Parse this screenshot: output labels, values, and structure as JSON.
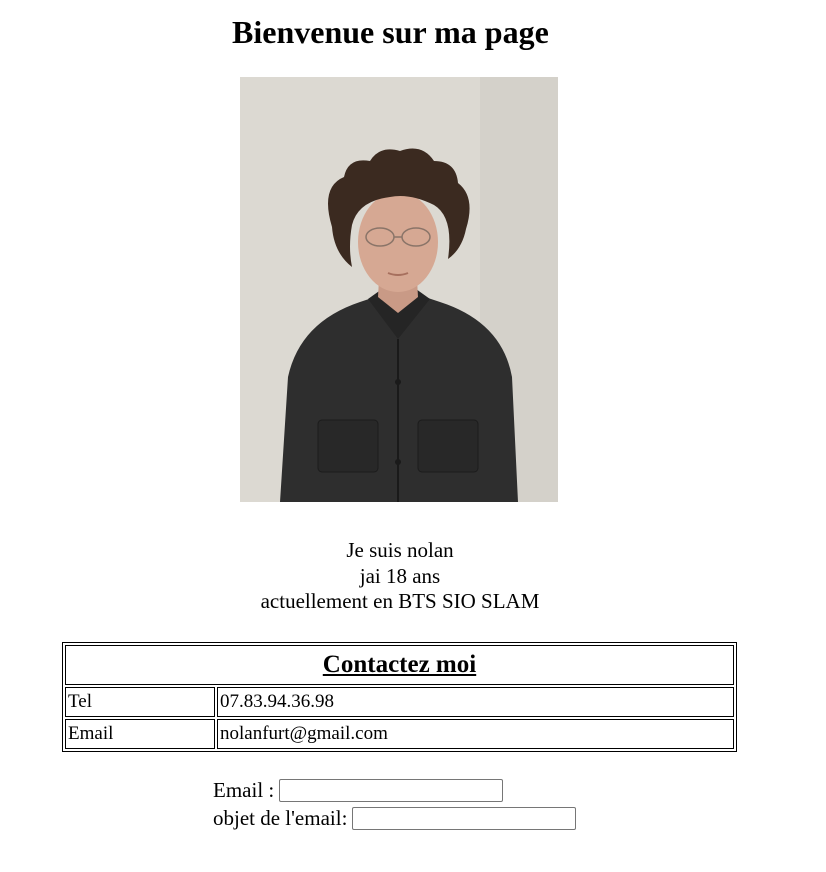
{
  "header": {
    "title": "Bienvenue sur ma page"
  },
  "intro": {
    "line1": "Je suis nolan",
    "line2": "jai 18 ans",
    "line3": "actuellement en BTS SIO SLAM"
  },
  "contact": {
    "heading": "Contactez moi",
    "rows": [
      {
        "label": "Tel",
        "value": "07.83.94.36.98"
      },
      {
        "label": "Email",
        "value": "nolanfurt@gmail.com"
      }
    ]
  },
  "form": {
    "email_label": "Email :",
    "email_value": "",
    "subject_label": "objet de l'email:",
    "subject_value": ""
  }
}
